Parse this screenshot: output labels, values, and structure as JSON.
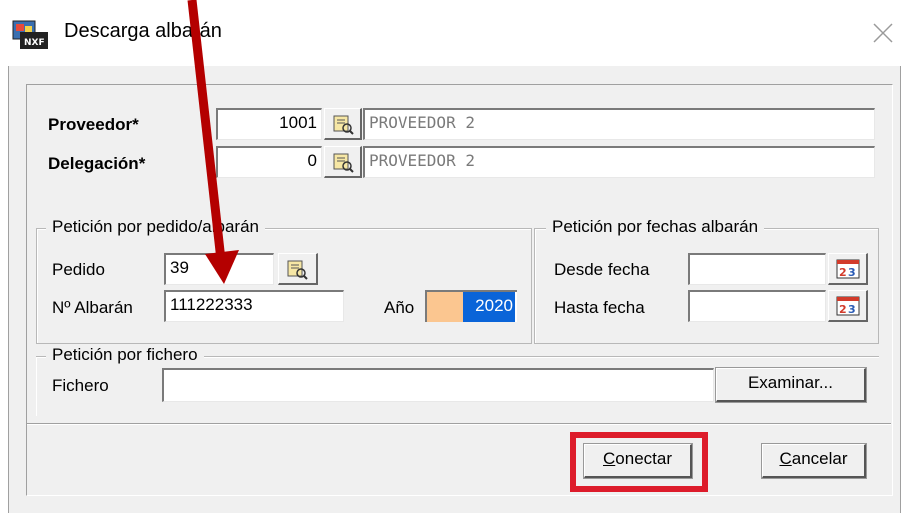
{
  "window": {
    "title": "Descarga albarán"
  },
  "proveedor": {
    "label": "Proveedor*",
    "code": "1001",
    "name": "PROVEEDOR 2"
  },
  "delegacion": {
    "label": "Delegación*",
    "code": "0",
    "name": "PROVEEDOR 2"
  },
  "peticion_pedido": {
    "legend": "Petición por pedido/albarán",
    "pedido_label": "Pedido",
    "pedido_value": "39",
    "albaran_label": "Nº Albarán",
    "albaran_value": "111222333",
    "anio_label": "Año",
    "anio_value": "2020"
  },
  "peticion_fechas": {
    "legend": "Petición por fechas albarán",
    "desde_label": "Desde fecha",
    "desde_value": "",
    "hasta_label": "Hasta fecha",
    "hasta_value": ""
  },
  "peticion_fichero": {
    "legend": "Petición por fichero",
    "fichero_label": "Fichero",
    "fichero_value": "",
    "browse_label": "Examinar..."
  },
  "buttons": {
    "connect_label": "Conectar",
    "cancel_label": "Cancelar"
  },
  "colors": {
    "highlight": "#dd1c2b",
    "arrow": "#b40000",
    "year_prefix": "#fbc690",
    "selection": "#0a64d8"
  }
}
